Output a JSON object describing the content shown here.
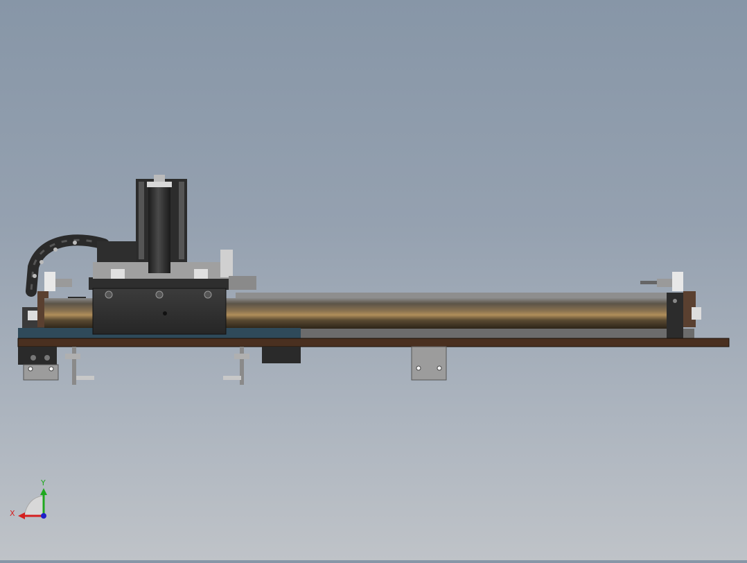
{
  "viewport": {
    "background_top": "#8796a7",
    "background_bottom": "#bfc3c8"
  },
  "model": {
    "rail_color": "#5a4a38",
    "base_plate_color": "#4a3020",
    "carriage_color": "#333333",
    "mount_color": "#9c9c9c",
    "blue_plate_color": "#2f4a5a"
  },
  "triad": {
    "x_label": "X",
    "y_label": "Y",
    "x_color": "#d42020",
    "y_color": "#1fa81f",
    "z_color": "#2020c8"
  }
}
